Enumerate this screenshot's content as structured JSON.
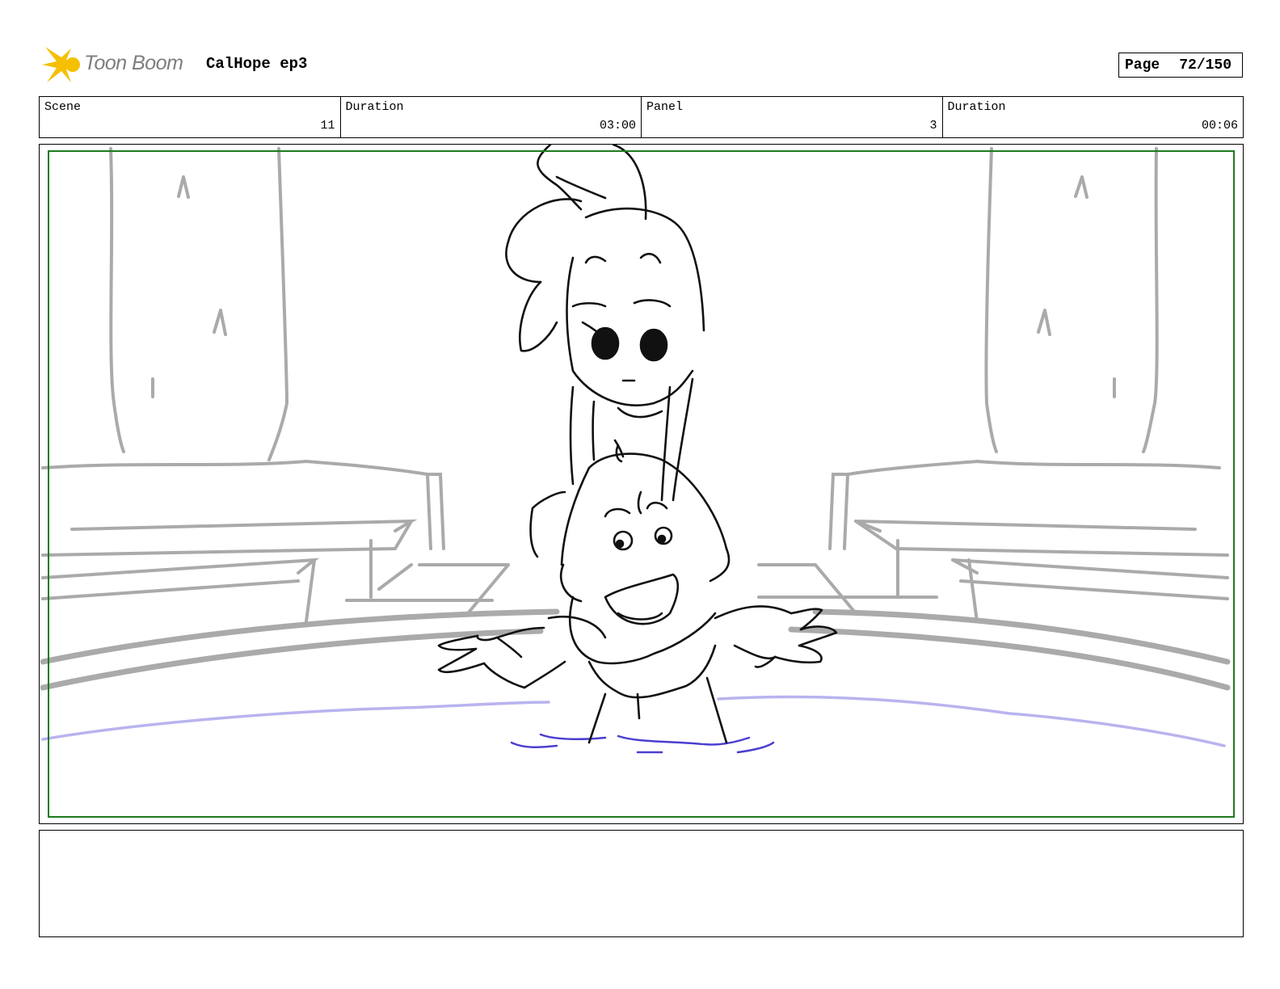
{
  "header": {
    "logo_text": "Toon Boom",
    "project_title": "CalHope ep3",
    "page_label": "Page",
    "page_number": "72/150"
  },
  "info": {
    "scene_label": "Scene",
    "scene_value": "11",
    "scene_duration_label": "Duration",
    "scene_duration_value": "03:00",
    "panel_label": "Panel",
    "panel_value": "3",
    "panel_duration_label": "Duration",
    "panel_duration_value": "00:06"
  },
  "colors": {
    "safe_frame": "#1f7a1f",
    "background_sketch": "#aaaaaa",
    "water_line": "#b9b3ef",
    "ripple": "#4a3fcf",
    "logo_star": "#f5c000"
  },
  "caption": {
    "text": ""
  }
}
